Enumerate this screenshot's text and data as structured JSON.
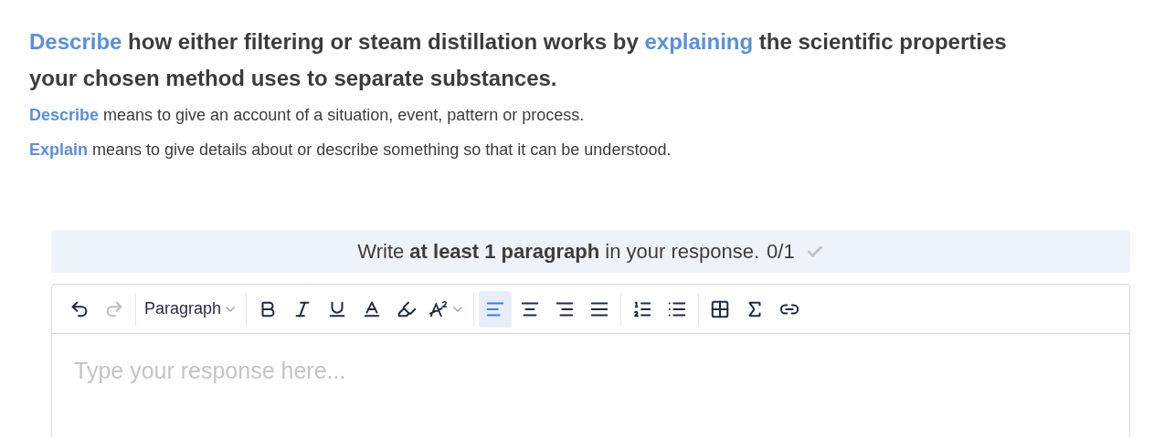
{
  "question": [
    {
      "kind": "term",
      "text": "Describe"
    },
    {
      "kind": "plain",
      "text": " how either filtering or steam distillation works by "
    },
    {
      "kind": "term",
      "text": "explaining"
    },
    {
      "kind": "plain",
      "text": " the scientific properties your chosen method uses to separate substances."
    }
  ],
  "definitions": [
    {
      "term": "Describe",
      "text": " means to give an account of a situation, event, pattern or process."
    },
    {
      "term": "Explain",
      "text": " means to give details about or describe something so that it can be understood."
    }
  ],
  "requirement": {
    "text": "Write **at least 1 paragraph** in your response.",
    "count": "0/1",
    "met": false
  },
  "toolbar": [
    {
      "kind": "button",
      "disabled": false,
      "selected": false
    },
    {
      "kind": "button",
      "disabled": true,
      "selected": false
    },
    {
      "kind": "dropdown",
      "label": "Paragraph",
      "disabled": false,
      "selected": false
    },
    {
      "kind": "button",
      "disabled": false,
      "selected": false
    },
    {
      "kind": "button",
      "disabled": false,
      "selected": false
    },
    {
      "kind": "button",
      "disabled": false,
      "selected": false
    },
    {
      "kind": "button",
      "disabled": false,
      "selected": false
    },
    {
      "kind": "button",
      "disabled": false,
      "selected": false
    },
    {
      "kind": "dropdown",
      "disabled": false,
      "selected": false
    },
    {
      "kind": "button",
      "disabled": false,
      "selected": true
    },
    {
      "kind": "button",
      "disabled": false,
      "selected": false
    },
    {
      "kind": "button",
      "disabled": false,
      "selected": false
    },
    {
      "kind": "button",
      "disabled": false,
      "selected": false
    },
    {
      "kind": "button",
      "disabled": false,
      "selected": false
    },
    {
      "kind": "button",
      "disabled": false,
      "selected": false
    },
    {
      "kind": "button",
      "disabled": false,
      "selected": false
    },
    {
      "kind": "button",
      "disabled": false,
      "selected": false
    },
    {
      "kind": "button",
      "disabled": false,
      "selected": false
    }
  ],
  "editor": {
    "placeholder": "Type your response here..."
  }
}
